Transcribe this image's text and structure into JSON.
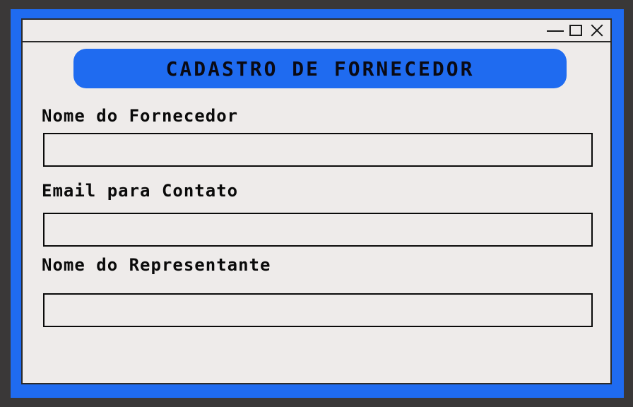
{
  "window": {
    "controls": {
      "minimize_icon": "minimize-icon",
      "maximize_icon": "maximize-icon",
      "close_icon": "close-icon"
    }
  },
  "header": {
    "title": "CADASTRO DE FORNECEDOR"
  },
  "form": {
    "fields": [
      {
        "label": "Nome do Fornecedor",
        "value": "",
        "placeholder": ""
      },
      {
        "label": "Email para Contato",
        "value": "",
        "placeholder": ""
      },
      {
        "label": "Nome do Representante",
        "value": "",
        "placeholder": ""
      }
    ]
  },
  "colors": {
    "accent": "#1f6bf0",
    "background": "#eeebea",
    "outer": "#3a3838"
  }
}
